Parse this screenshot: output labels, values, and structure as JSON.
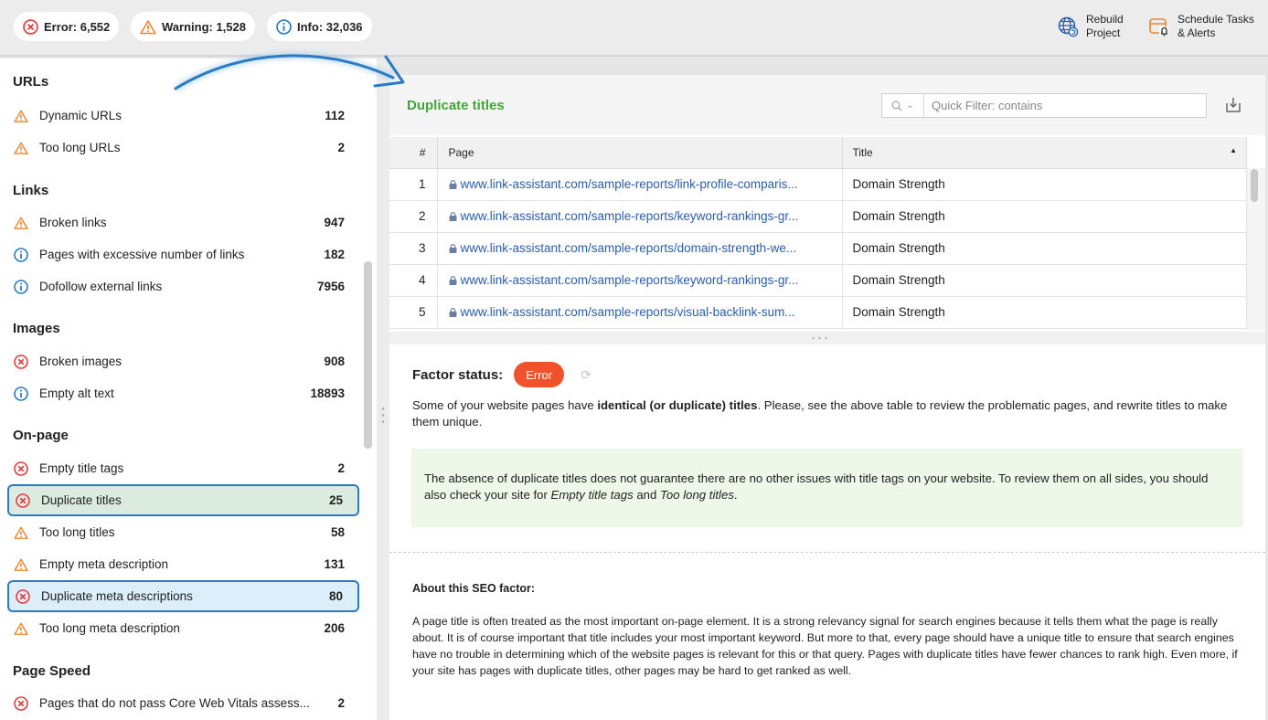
{
  "status": {
    "error": {
      "label": "Error: 6,552",
      "color": "#e33d3d"
    },
    "warning": {
      "label": "Warning: 1,528",
      "color": "#f0852d"
    },
    "info": {
      "label": "Info: 32,036",
      "color": "#2b7bc4"
    }
  },
  "toolbar": {
    "rebuild_line1": "Rebuild",
    "rebuild_line2": "Project",
    "schedule_line1": "Schedule Tasks",
    "schedule_line2": "& Alerts"
  },
  "sidebar": {
    "sections": [
      {
        "title": "URLs",
        "items": [
          {
            "label": "Dynamic URLs",
            "count": "112",
            "type": "warning"
          },
          {
            "label": "Too long URLs",
            "count": "2",
            "type": "warning"
          }
        ]
      },
      {
        "title": "Links",
        "items": [
          {
            "label": "Broken links",
            "count": "947",
            "type": "warning"
          },
          {
            "label": "Pages with excessive number of links",
            "count": "182",
            "type": "info"
          },
          {
            "label": "Dofollow external links",
            "count": "7956",
            "type": "info"
          }
        ]
      },
      {
        "title": "Images",
        "items": [
          {
            "label": "Broken images",
            "count": "908",
            "type": "error"
          },
          {
            "label": "Empty alt text",
            "count": "18893",
            "type": "info"
          }
        ]
      },
      {
        "title": "On-page",
        "items": [
          {
            "label": "Empty title tags",
            "count": "2",
            "type": "error"
          },
          {
            "label": "Duplicate titles",
            "count": "25",
            "type": "error",
            "selected": "green"
          },
          {
            "label": "Too long titles",
            "count": "58",
            "type": "warning"
          },
          {
            "label": "Empty meta description",
            "count": "131",
            "type": "warning"
          },
          {
            "label": "Duplicate meta descriptions",
            "count": "80",
            "type": "error",
            "selected": "blue"
          },
          {
            "label": "Too long meta description",
            "count": "206",
            "type": "warning"
          }
        ]
      },
      {
        "title": "Page Speed",
        "items": [
          {
            "label": "Pages that do not pass Core Web Vitals assess...",
            "count": "2",
            "type": "error"
          }
        ]
      }
    ]
  },
  "main": {
    "title": "Duplicate titles",
    "quick_filter_placeholder": "Quick Filter: contains",
    "table": {
      "headers": {
        "num": "#",
        "page": "Page",
        "title": "Title"
      },
      "rows": [
        {
          "num": "1",
          "page": "www.link-assistant.com/sample-reports/link-profile-comparis...",
          "title": "Domain Strength"
        },
        {
          "num": "2",
          "page": "www.link-assistant.com/sample-reports/keyword-rankings-gr...",
          "title": "Domain Strength"
        },
        {
          "num": "3",
          "page": "www.link-assistant.com/sample-reports/domain-strength-we...",
          "title": "Domain Strength"
        },
        {
          "num": "4",
          "page": "www.link-assistant.com/sample-reports/keyword-rankings-gr...",
          "title": "Domain Strength"
        },
        {
          "num": "5",
          "page": "www.link-assistant.com/sample-reports/visual-backlink-sum...",
          "title": "Domain Strength"
        }
      ]
    },
    "factor_label": "Factor status:",
    "factor_status": "Error",
    "desc_part1": "Some of your website pages have ",
    "desc_bold": "identical (or duplicate) titles",
    "desc_part2": ". Please, see the above table to review the problematic pages, and rewrite titles to make them unique.",
    "note_part1": "The absence of duplicate titles does not guarantee there are no other issues with title tags on your website. To review them on all sides, you should also check your site for ",
    "note_em1": "Empty title tags",
    "note_and": " and ",
    "note_em2": "Too long titles",
    "note_end": ".",
    "about_title": "About this SEO factor:",
    "about_text": "A page title is often treated as the most important on-page element. It is a strong relevancy signal for search engines because it tells them what the page is really about. It is of course important that title includes your most important keyword. But more to that, every page should have a unique title to ensure that search engines have no trouble in determining which of the website pages is relevant for this or that query. Pages with duplicate titles have fewer chances to rank high. Even more, if your site has pages with duplicate titles, other pages may be hard to get ranked as well."
  }
}
